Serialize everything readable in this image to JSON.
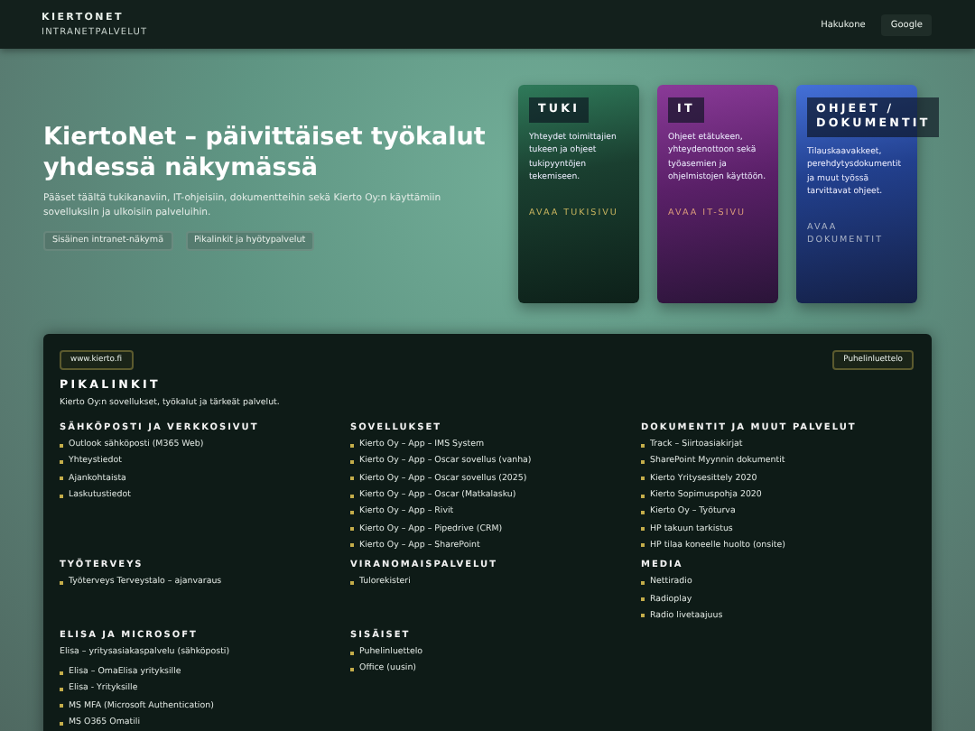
{
  "header": {
    "brand": "KIERTONET",
    "subtitle": "INTRANETPALVELUT",
    "nav": [
      {
        "label": "Hakukone",
        "selected": false
      },
      {
        "label": "Google",
        "selected": true
      }
    ]
  },
  "hero": {
    "title": "KiertoNet – päivittäiset työkalut yhdessä näkymässä",
    "lead": "Pääset täältä tukikanaviin, IT-ohjeisiin, dokumentteihin sekä Kierto Oy:n käyttämiin sovelluksiin ja ulkoisiin palveluihin.",
    "chips": [
      "Sisäinen intranet-näkymä",
      "Pikalinkit ja hyötypalvelut"
    ]
  },
  "cards": [
    {
      "kind": "green",
      "title": "TUKI",
      "text": "Yhteydet toimittajien tukeen ja ohjeet tukipyyntöjen tekemiseen.",
      "link": "AVAA TUKISIVU"
    },
    {
      "kind": "purple",
      "title": "IT",
      "text": "Ohjeet etätukeen, yhteydenottoon sekä työasemien ja ohjelmistojen käyttöön.",
      "link": "AVAA IT-SIVU"
    },
    {
      "kind": "blue",
      "title": "OHJEET / DOKUMENTIT",
      "text": "Tilauskaavakkeet, perehdytysdokumentit ja muut työssä tarvittavat ohjeet.",
      "link": "AVAA DOKUMENTIT"
    }
  ],
  "panel": {
    "left_button": "www.kierto.fi",
    "right_button": "Puhelinluettelo",
    "title": "PIKALINKIT",
    "lead": "Kierto Oy:n sovellukset, työkalut ja tärkeät palvelut.",
    "sections": [
      {
        "title": "SÄHKÖPOSTI JA VERKKOSIVUT",
        "items": [
          "Outlook sähköposti (M365 Web)",
          "Yhteystiedot",
          "Ajankohtaista",
          "Laskutustiedot"
        ]
      },
      {
        "title": "SOVELLUKSET",
        "items": [
          "Kierto Oy – App – IMS System",
          "Kierto Oy – App – Oscar sovellus (vanha)",
          "Kierto Oy – App – Oscar sovellus (2025)",
          "Kierto Oy – App – Oscar (Matkalasku)",
          "Kierto Oy – App – Rivit",
          "Kierto Oy – App – Pipedrive (CRM)",
          "Kierto Oy – App – SharePoint"
        ]
      },
      {
        "title": "DOKUMENTIT JA MUUT PALVELUT",
        "items": [
          "Track – Siirtoasiakirjat",
          "SharePoint Myynnin dokumentit",
          "Kierto Yritysesittely 2020",
          "Kierto Sopimuspohja 2020",
          "Kierto Oy – Työturva",
          "HP takuun tarkistus",
          "HP tilaa koneelle huolto (onsite)"
        ]
      },
      {
        "title": "TYÖTERVEYS",
        "items": [
          "Työterveys Terveystalo – ajanvaraus"
        ]
      },
      {
        "title": "VIRANOMAISPALVELUT",
        "items": [
          "Tulorekisteri"
        ]
      },
      {
        "title": "MEDIA",
        "items": [
          "Nettiradio",
          "Radioplay",
          "Radio livetaajuus"
        ]
      },
      {
        "title": "ELISA JA MICROSOFT",
        "intro": "Elisa – yritysasiakaspalvelu (sähköposti)",
        "items": [
          "Elisa – OmaElisa yrityksille",
          "Elisa - Yrityksille",
          "MS MFA (Microsoft Authentication)",
          "MS O365 Omatili"
        ]
      },
      {
        "title": "SISÄISET",
        "items": [
          "Puhelinluettelo",
          "Office (uusin)"
        ]
      }
    ]
  }
}
